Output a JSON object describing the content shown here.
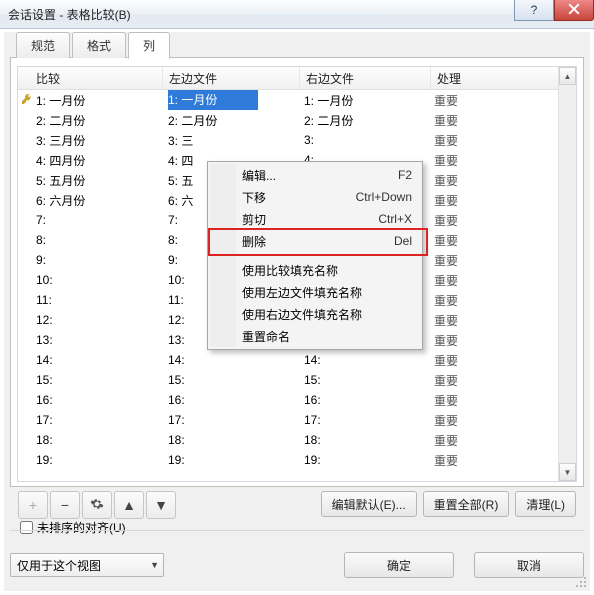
{
  "window": {
    "title": "会话设置 - 表格比较(B)"
  },
  "tabs": [
    {
      "label": "规范"
    },
    {
      "label": "格式"
    },
    {
      "label": "列"
    }
  ],
  "active_tab": 2,
  "columns": {
    "cmp": "比较",
    "left": "左边文件",
    "right": "右边文件",
    "proc": "处理"
  },
  "rows": [
    {
      "idx": "1:",
      "cmp": "一月份",
      "left": "一月份",
      "right": "一月份",
      "proc": "重要",
      "key": true,
      "left_selected": true
    },
    {
      "idx": "2:",
      "cmp": "二月份",
      "left": "二月份",
      "right": "二月份",
      "proc": "重要"
    },
    {
      "idx": "3:",
      "cmp": "三月份",
      "left": "三",
      "right": "",
      "proc": "重要"
    },
    {
      "idx": "4:",
      "cmp": "四月份",
      "left": "四",
      "right": "",
      "proc": "重要"
    },
    {
      "idx": "5:",
      "cmp": "五月份",
      "left": "五",
      "right": "",
      "proc": "重要"
    },
    {
      "idx": "6:",
      "cmp": "六月份",
      "left": "六",
      "right": "",
      "proc": "重要"
    },
    {
      "idx": "7:",
      "cmp": "",
      "left": "",
      "right": "",
      "proc": "重要"
    },
    {
      "idx": "8:",
      "cmp": "",
      "left": "",
      "right": "",
      "proc": "重要"
    },
    {
      "idx": "9:",
      "cmp": "",
      "left": "",
      "right": "",
      "proc": "重要"
    },
    {
      "idx": "10:",
      "cmp": "",
      "left": "",
      "right": "",
      "proc": "重要"
    },
    {
      "idx": "11:",
      "cmp": "",
      "left": "",
      "right": "",
      "proc": "重要"
    },
    {
      "idx": "12:",
      "cmp": "",
      "left": "",
      "right": "",
      "proc": "重要"
    },
    {
      "idx": "13:",
      "cmp": "",
      "left": "",
      "right": "",
      "proc": "重要"
    },
    {
      "idx": "14:",
      "cmp": "",
      "left": "",
      "right": "",
      "proc": "重要"
    },
    {
      "idx": "15:",
      "cmp": "",
      "left": "",
      "right": "",
      "proc": "重要"
    },
    {
      "idx": "16:",
      "cmp": "",
      "left": "",
      "right": "",
      "proc": "重要"
    },
    {
      "idx": "17:",
      "cmp": "",
      "left": "",
      "right": "",
      "proc": "重要"
    },
    {
      "idx": "18:",
      "cmp": "",
      "left": "",
      "right": "",
      "proc": "重要"
    },
    {
      "idx": "19:",
      "cmp": "",
      "left": "",
      "right": "",
      "proc": "重要"
    }
  ],
  "context_menu": [
    {
      "label": "编辑...",
      "shortcut": "F2"
    },
    {
      "label": "下移",
      "shortcut": "Ctrl+Down"
    },
    {
      "label": "剪切",
      "shortcut": "Ctrl+X"
    },
    {
      "label": "删除",
      "shortcut": "Del",
      "highlighted": true
    },
    {
      "sep": true
    },
    {
      "label": "使用比较填充名称"
    },
    {
      "label": "使用左边文件填充名称"
    },
    {
      "label": "使用右边文件填充名称"
    },
    {
      "label": "重置命名"
    }
  ],
  "toolbar": {
    "edit_defaults": "编辑默认(E)...",
    "reset_all": "重置全部(R)",
    "clear": "清理(L)"
  },
  "checkbox": {
    "unsorted_align": "未排序的对齐(U)"
  },
  "bottom": {
    "scope": "仅用于这个视图",
    "ok": "确定",
    "cancel": "取消"
  },
  "icons": {
    "add": "+",
    "remove": "−",
    "help": "?"
  }
}
